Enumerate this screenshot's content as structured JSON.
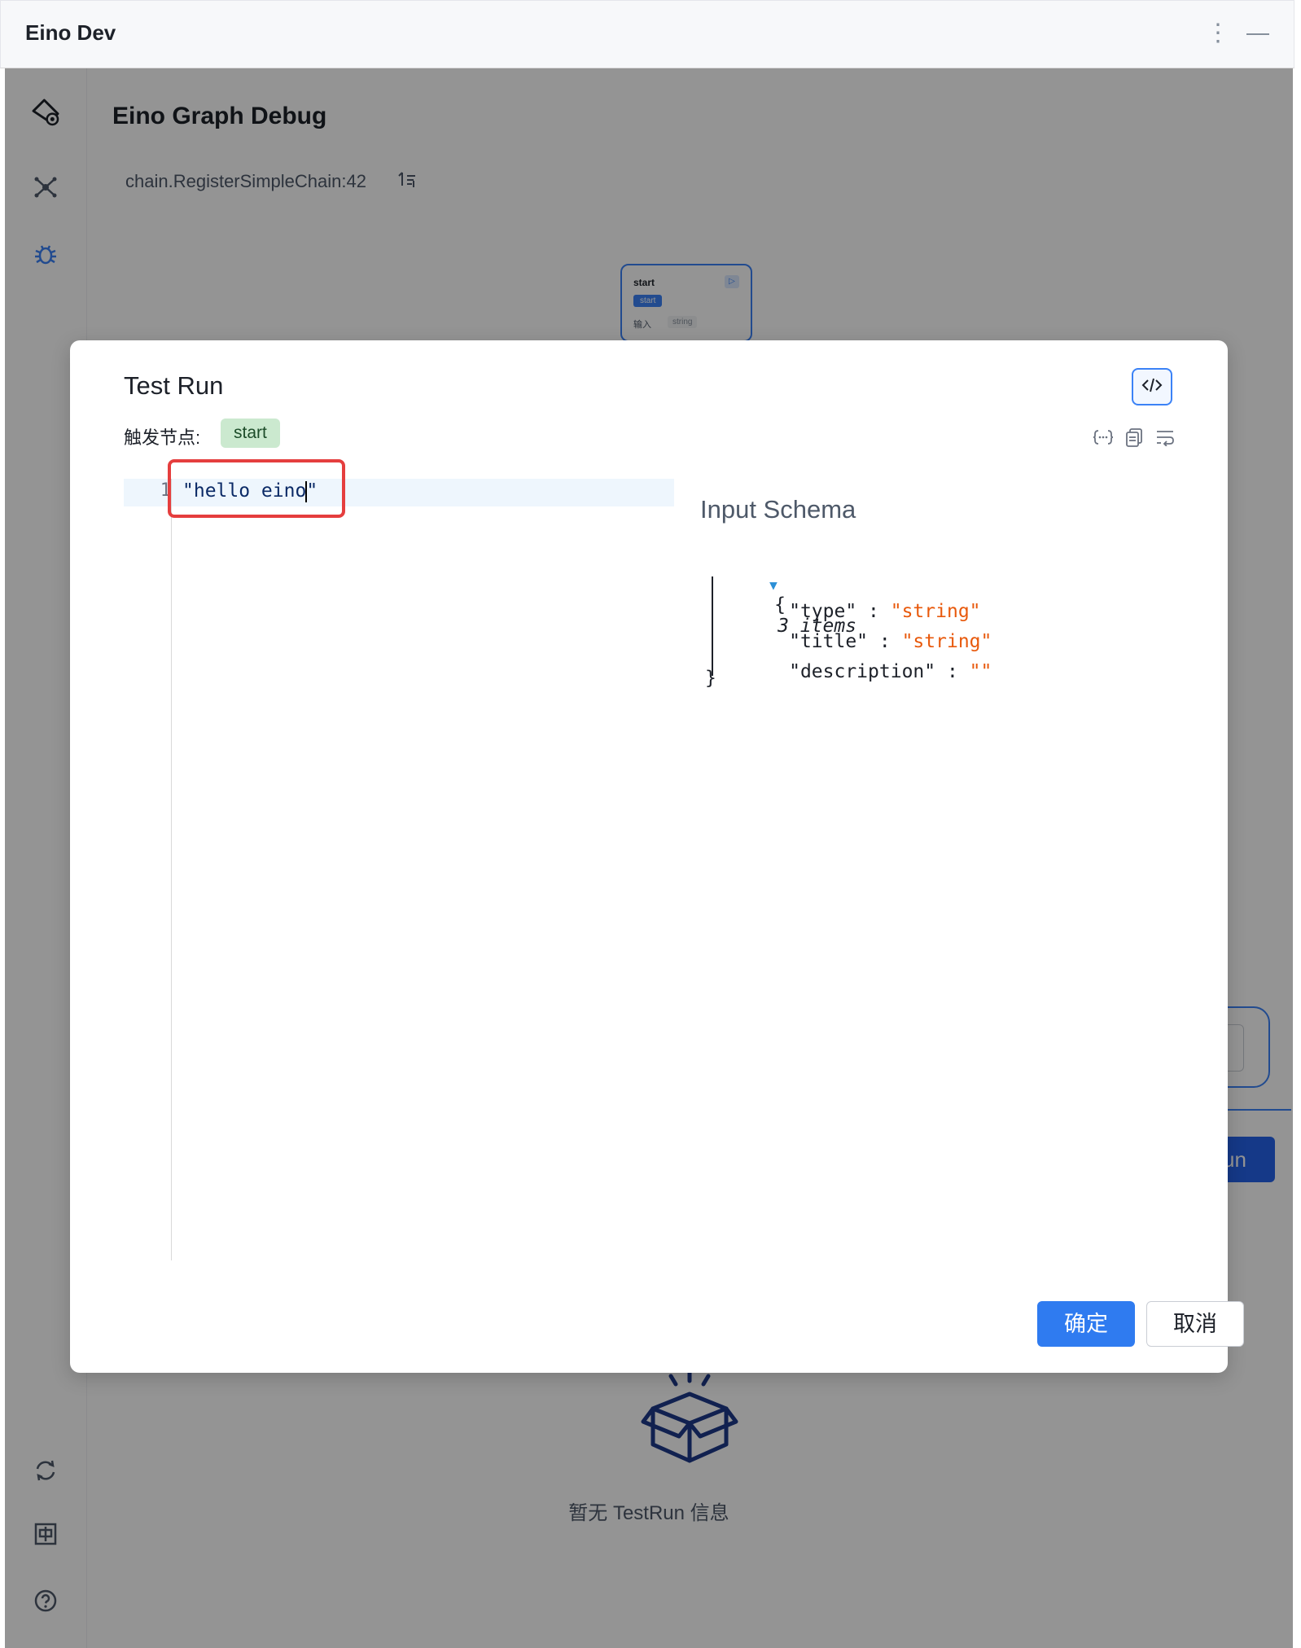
{
  "window": {
    "title": "Eino Dev"
  },
  "page": {
    "title": "Eino Graph Debug",
    "breadcrumb": "chain.RegisterSimpleChain:42"
  },
  "graph_node": {
    "title": "start",
    "badge": "start",
    "input_label": "输入",
    "input_type": "string"
  },
  "background": {
    "empty_text": "暂无 TestRun 信息",
    "run_button_partial": "un"
  },
  "modal": {
    "title": "Test Run",
    "trigger_label": "触发节点:",
    "trigger_node": "start",
    "editor": {
      "line_number": "1",
      "text_before_cursor": "\"hello eino",
      "text_after_cursor": "\""
    },
    "schema": {
      "title": "Input Schema",
      "open_brace": "{",
      "item_count": "3 items",
      "rows": [
        {
          "key": "\"type\"",
          "sep": " : ",
          "value": "\"string\""
        },
        {
          "key": "\"title\"",
          "sep": " : ",
          "value": "\"string\""
        },
        {
          "key": "\"description\"",
          "sep": " : ",
          "value": "\"\""
        }
      ],
      "close_brace": "}"
    },
    "ok_label": "确定",
    "cancel_label": "取消"
  },
  "colors": {
    "primary": "#2f7bf0",
    "highlight_border": "#e53e3e",
    "schema_string": "#e8590c",
    "trigger_tag_bg": "#cbe9cf"
  },
  "icons": [
    "gear-logo-icon",
    "graph-icon",
    "bug-icon",
    "refresh-icon",
    "language-icon",
    "help-icon",
    "code-view-icon",
    "format-icon",
    "copy-icon",
    "wrap-icon",
    "sort-icon",
    "empty-box-icon"
  ]
}
